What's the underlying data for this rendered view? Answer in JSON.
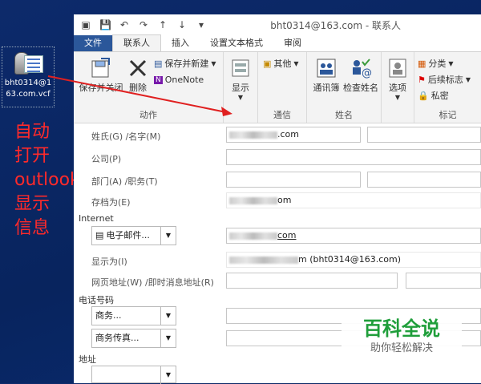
{
  "desktop": {
    "icon_file_name": "bht0314@163.com.vcf",
    "caption_lines": [
      "自动",
      "打开",
      "outlook",
      "显示",
      "信息"
    ],
    "caption_color": "#ff2a2a"
  },
  "window": {
    "title": "bht0314@163.com - 联系人",
    "qat_icons": [
      "contact-card-icon",
      "save-icon",
      "undo-icon",
      "redo-icon",
      "up-arrow-icon",
      "down-arrow-icon",
      "customize-icon"
    ]
  },
  "tabs": [
    {
      "label": "文件",
      "active": false
    },
    {
      "label": "联系人",
      "active": true
    },
    {
      "label": "插入",
      "active": false
    },
    {
      "label": "设置文本格式",
      "active": false
    },
    {
      "label": "审阅",
      "active": false
    }
  ],
  "ribbon": {
    "groups": {
      "actions": {
        "label": "动作",
        "save_close": "保存并关闭",
        "delete": "删除",
        "save_new": "保存并新建",
        "onenote": "OneNote"
      },
      "show": {
        "display": "显示"
      },
      "communicate": {
        "label": "通信",
        "more": "其他"
      },
      "names": {
        "label": "姓名",
        "address_book": "通讯簿",
        "check_names": "检查姓名"
      },
      "options": {
        "options": "选项"
      },
      "tags": {
        "label": "标记",
        "categorize": "分类",
        "follow_up": "后续标志",
        "private": "私密"
      }
    }
  },
  "form": {
    "labels": {
      "full_name": "姓氏(G)  /名字(M)",
      "company": "公司(P)",
      "department": "部门(A)  /职务(T)",
      "file_as": "存档为(E)",
      "internet": "Internet",
      "display_as": "显示为(I)",
      "web_im": "网页地址(W)  /即时消息地址(R)",
      "phone_numbers": "电话号码",
      "address": "地址"
    },
    "values": {
      "last_name_suffix": ".com",
      "file_as_suffix": "om",
      "email_suffix": "com",
      "display_as_suffix": "m (bht0314@163.com)"
    },
    "email_combo": "电子邮件...",
    "phone_business": "商务...",
    "phone_business_fax": "商务传真..."
  },
  "watermark": {
    "title": "百科全说",
    "subtitle": "助你轻松解决",
    "color": "#1f9e3a"
  }
}
